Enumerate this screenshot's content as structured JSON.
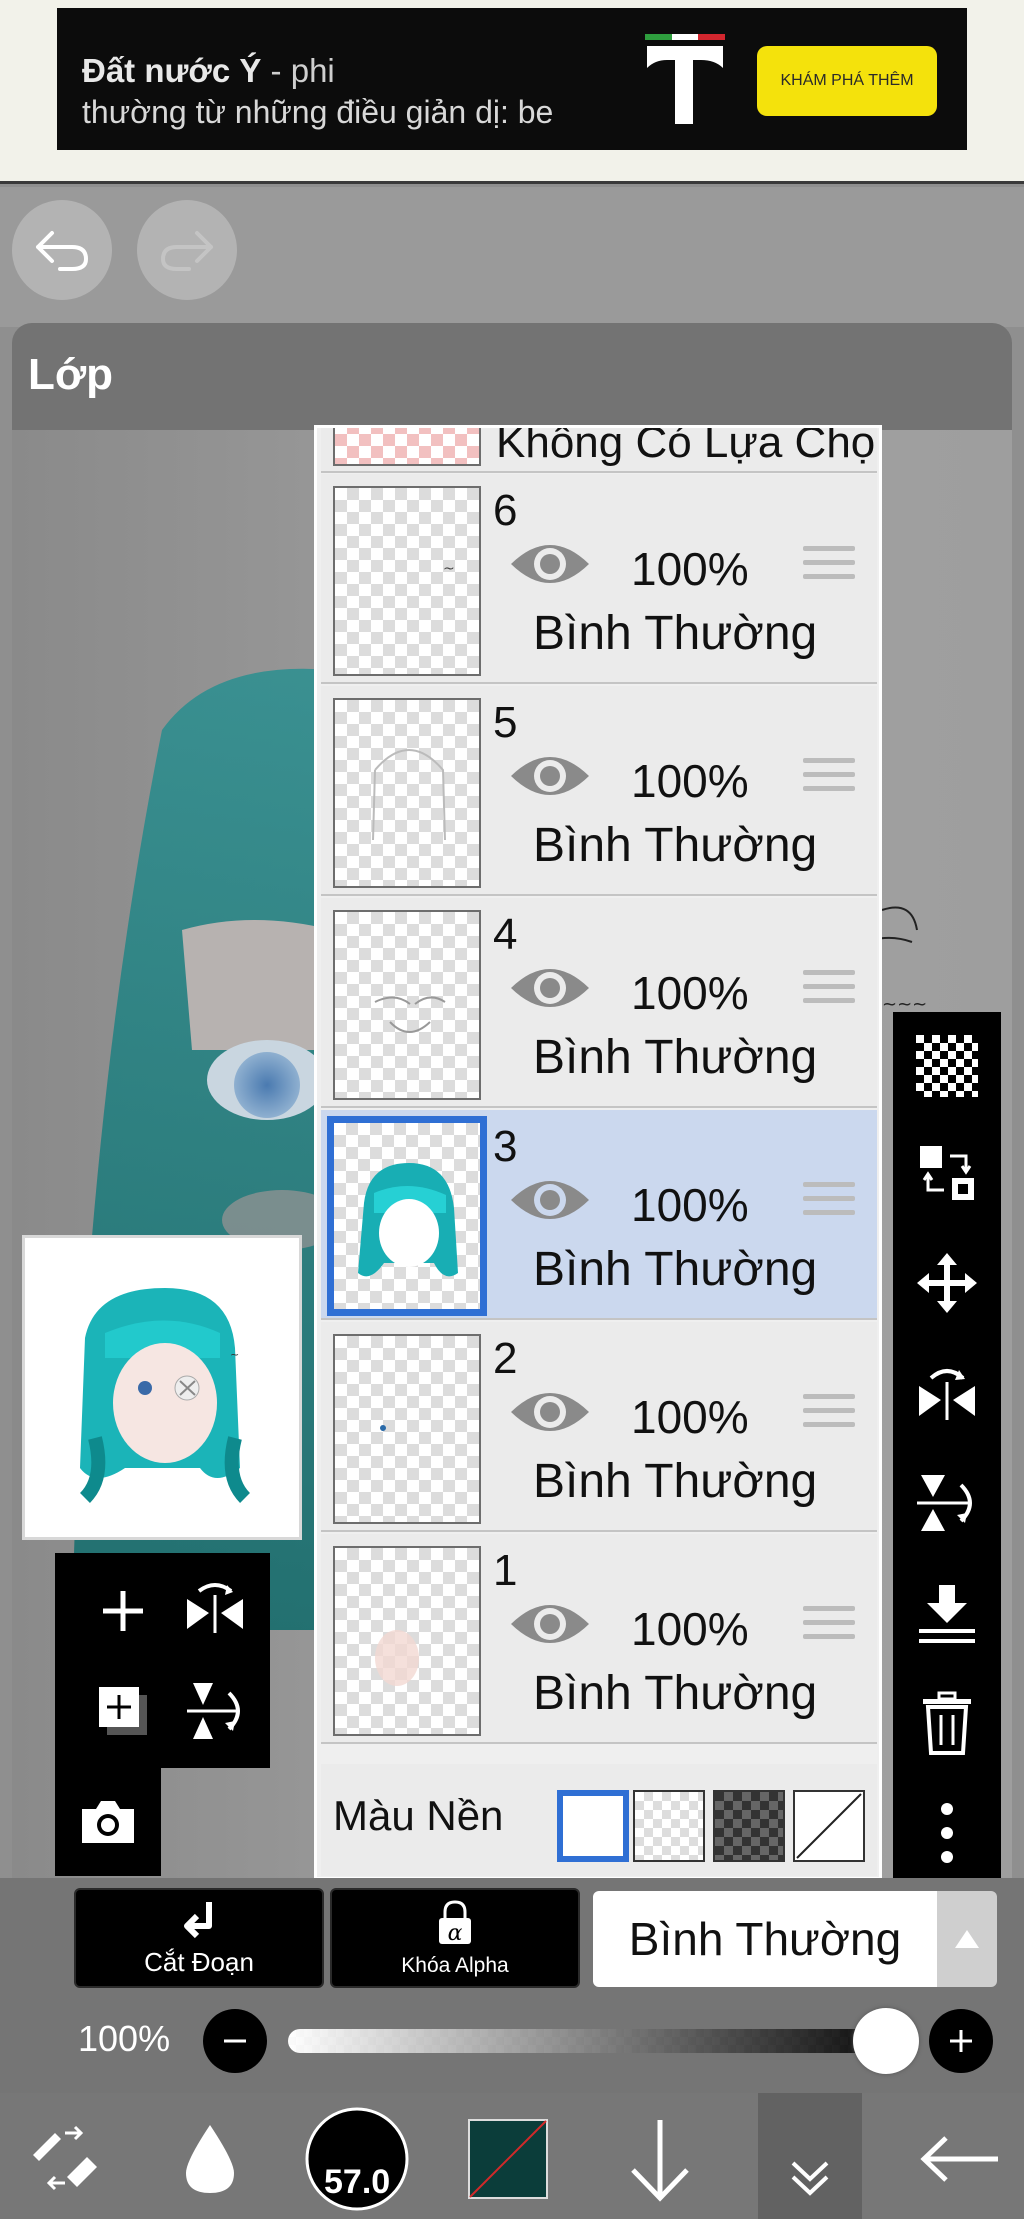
{
  "ad": {
    "title_bold": "Đất nước Ý",
    "title_light": " - phi",
    "subtitle": "thường từ những điều giản dị: be",
    "cta": "KHÁM PHÁ THÊM"
  },
  "topbar": {
    "undo_icon": "undo-icon",
    "redo_icon": "redo-icon"
  },
  "layer_window": {
    "title": "Lớp"
  },
  "layers": {
    "no_selection_label": "Không Có Lựa Chọn",
    "rows": [
      {
        "number": "6",
        "opacity": "100%",
        "blend": "Bình Thường",
        "selected": false
      },
      {
        "number": "5",
        "opacity": "100%",
        "blend": "Bình Thường",
        "selected": false
      },
      {
        "number": "4",
        "opacity": "100%",
        "blend": "Bình Thường",
        "selected": false
      },
      {
        "number": "3",
        "opacity": "100%",
        "blend": "Bình Thường",
        "selected": true
      },
      {
        "number": "2",
        "opacity": "100%",
        "blend": "Bình Thường",
        "selected": false
      },
      {
        "number": "1",
        "opacity": "100%",
        "blend": "Bình Thường",
        "selected": false
      }
    ],
    "background_label": "Màu Nền"
  },
  "options": {
    "clip_label": "Cắt Đoạn",
    "alpha_lock_label": "Khóa Alpha",
    "blend_mode": "Bình Thường",
    "opacity_value": "100%",
    "opacity_level": 1.0
  },
  "toolbar": {
    "brush_size": "57.0",
    "color_hex": "#0b3d3a"
  },
  "colors": {
    "accent": "#2f6fd4",
    "selected_row": "#cbd8ee",
    "ad_button": "#f4e20c",
    "hair": "#1b9aa0"
  }
}
